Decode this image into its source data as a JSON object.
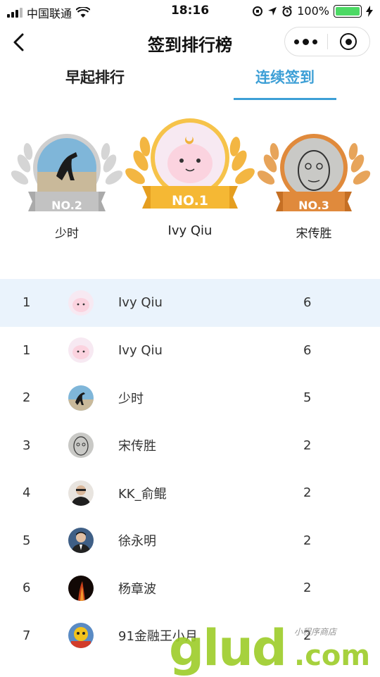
{
  "status": {
    "carrier": "中国联通",
    "time": "18:16",
    "battery": "100%"
  },
  "nav": {
    "title": "签到排行榜"
  },
  "tabs": [
    {
      "label": "早起排行"
    },
    {
      "label": "连续签到"
    }
  ],
  "podium": [
    {
      "badge": "NO.2",
      "name": "少时"
    },
    {
      "badge": "NO.1",
      "name": "Ivy Qiu"
    },
    {
      "badge": "NO.3",
      "name": "宋传胜"
    }
  ],
  "list": [
    {
      "rank": "1",
      "name": "Ivy Qiu",
      "count": "6"
    },
    {
      "rank": "1",
      "name": "Ivy Qiu",
      "count": "6"
    },
    {
      "rank": "2",
      "name": "少时",
      "count": "5"
    },
    {
      "rank": "3",
      "name": "宋传胜",
      "count": "2"
    },
    {
      "rank": "4",
      "name": "KK_俞鲲",
      "count": "2"
    },
    {
      "rank": "5",
      "name": "徐永明",
      "count": "2"
    },
    {
      "rank": "6",
      "name": "杨章波",
      "count": "2"
    },
    {
      "rank": "7",
      "name": "91金融王小月",
      "count": "2"
    }
  ],
  "watermark": {
    "brand": "glud",
    "domain": ".com",
    "tagline": "小程序商店"
  },
  "colors": {
    "accent": "#3d9fd6",
    "gold": "#f5b834",
    "silver": "#c8c8c8",
    "bronze": "#e08a3c",
    "highlight": "#eaf3fc"
  }
}
